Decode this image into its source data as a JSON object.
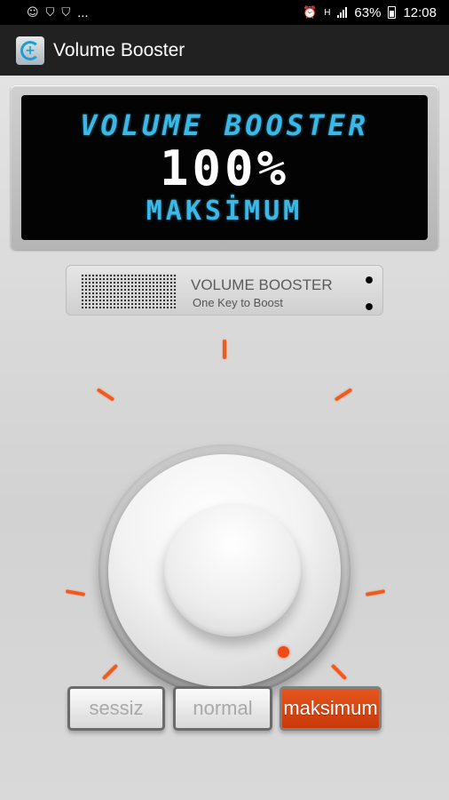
{
  "status_bar": {
    "left_more": "...",
    "battery": "63%",
    "time": "12:08",
    "network": "H",
    "icons": [
      "assistant-icon",
      "shield-icon",
      "shield-icon",
      "alarm-icon",
      "signal-icon",
      "battery-icon"
    ]
  },
  "app_bar": {
    "title": "Volume Booster",
    "logo_icon": "volume-plus-icon"
  },
  "lcd": {
    "title": "VOLUME BOOSTER",
    "value": "100%",
    "mode": "MAKSİMUM"
  },
  "badge": {
    "title": "VOLUME BOOSTER",
    "subtitle": "One Key to Boost"
  },
  "knob": {
    "level": 1.0
  },
  "modes": [
    {
      "label": "sessiz",
      "active": false
    },
    {
      "label": "normal",
      "active": false
    },
    {
      "label": "maksimum",
      "active": true
    }
  ],
  "colors": {
    "accent": "#f05a1e",
    "lcd_text": "#3bb8e6",
    "app_bar": "#212121"
  }
}
